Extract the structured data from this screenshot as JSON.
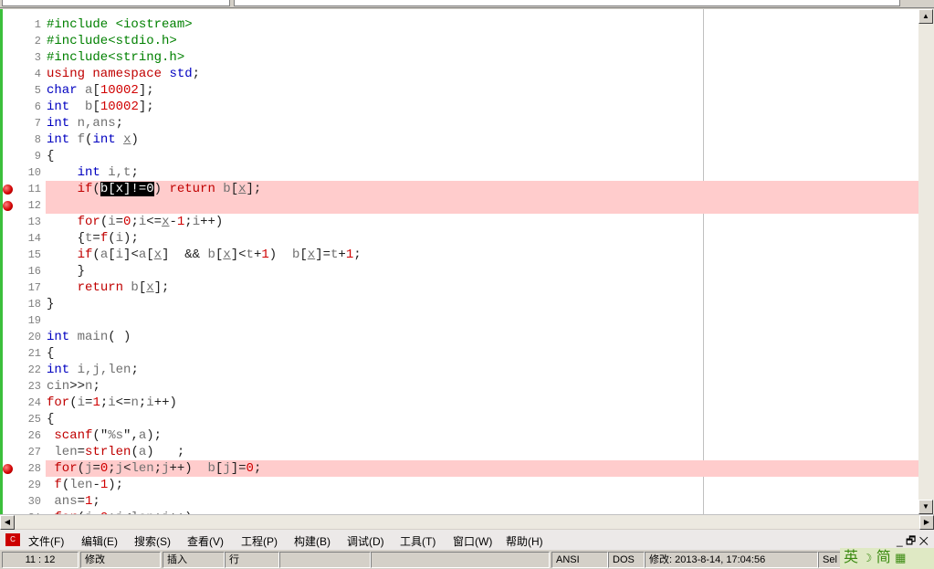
{
  "editor": {
    "breakpoint_color": "#ffcccc",
    "lines": [
      {
        "n": "1",
        "t": [
          [
            "p",
            "#include <iostream>"
          ]
        ]
      },
      {
        "n": "2",
        "t": [
          [
            "p",
            "#include<stdio.h>"
          ]
        ]
      },
      {
        "n": "3",
        "t": [
          [
            "p",
            "#include<string.h>"
          ]
        ]
      },
      {
        "n": "4",
        "t": [
          [
            "r",
            "using namespace"
          ],
          [
            "o",
            " "
          ],
          [
            "k",
            "std"
          ],
          [
            "o",
            ";"
          ]
        ]
      },
      {
        "n": "5",
        "t": [
          [
            "k",
            "char"
          ],
          [
            "i",
            " a"
          ],
          [
            "o",
            "["
          ],
          [
            "n",
            "10002"
          ],
          [
            "o",
            "];"
          ]
        ]
      },
      {
        "n": "6",
        "t": [
          [
            "k",
            "int"
          ],
          [
            "i",
            "  b"
          ],
          [
            "o",
            "["
          ],
          [
            "n",
            "10002"
          ],
          [
            "o",
            "];"
          ]
        ]
      },
      {
        "n": "7",
        "t": [
          [
            "k",
            "int"
          ],
          [
            "i",
            " n,ans"
          ],
          [
            "o",
            ";"
          ]
        ]
      },
      {
        "n": "8",
        "t": [
          [
            "k",
            "int"
          ],
          [
            "i",
            " f"
          ],
          [
            "o",
            "("
          ],
          [
            "k",
            "int"
          ],
          [
            "i",
            " "
          ],
          [
            "u",
            "x"
          ],
          [
            "o",
            ")"
          ]
        ]
      },
      {
        "n": "9",
        "t": [
          [
            "o",
            "{"
          ]
        ]
      },
      {
        "n": "10",
        "t": [
          [
            "i",
            "    "
          ],
          [
            "k",
            "int"
          ],
          [
            "i",
            " i,t"
          ],
          [
            "o",
            ";"
          ]
        ]
      },
      {
        "n": "11",
        "bp": true,
        "t": [
          [
            "i",
            "    "
          ],
          [
            "r",
            "if"
          ],
          [
            "o",
            "("
          ],
          [
            "s",
            "b[x]!=0"
          ],
          [
            "o",
            ")"
          ],
          [
            "i",
            " "
          ],
          [
            "r",
            "return"
          ],
          [
            "i",
            " b"
          ],
          [
            "o",
            "["
          ],
          [
            "u",
            "x"
          ],
          [
            "o",
            "];"
          ]
        ]
      },
      {
        "n": "12",
        "bp": true,
        "t": []
      },
      {
        "n": "13",
        "t": [
          [
            "i",
            "    "
          ],
          [
            "r",
            "for"
          ],
          [
            "o",
            "("
          ],
          [
            "i",
            "i"
          ],
          [
            "o",
            "="
          ],
          [
            "n",
            "0"
          ],
          [
            "o",
            ";"
          ],
          [
            "i",
            "i"
          ],
          [
            "o",
            "<="
          ],
          [
            "u",
            "x"
          ],
          [
            "o",
            "-"
          ],
          [
            "n",
            "1"
          ],
          [
            "o",
            ";"
          ],
          [
            "i",
            "i"
          ],
          [
            "o",
            "++)"
          ]
        ]
      },
      {
        "n": "14",
        "t": [
          [
            "i",
            "    "
          ],
          [
            "o",
            "{"
          ],
          [
            "i",
            "t"
          ],
          [
            "o",
            "="
          ],
          [
            "r",
            "f"
          ],
          [
            "o",
            "("
          ],
          [
            "i",
            "i"
          ],
          [
            "o",
            ");"
          ]
        ]
      },
      {
        "n": "15",
        "t": [
          [
            "i",
            "    "
          ],
          [
            "r",
            "if"
          ],
          [
            "o",
            "("
          ],
          [
            "i",
            "a"
          ],
          [
            "o",
            "["
          ],
          [
            "i",
            "i"
          ],
          [
            "o",
            "]<"
          ],
          [
            "i",
            "a"
          ],
          [
            "o",
            "["
          ],
          [
            "u",
            "x"
          ],
          [
            "o",
            "]  && "
          ],
          [
            "i",
            "b"
          ],
          [
            "o",
            "["
          ],
          [
            "u",
            "x"
          ],
          [
            "o",
            "]<"
          ],
          [
            "i",
            "t"
          ],
          [
            "o",
            "+"
          ],
          [
            "n",
            "1"
          ],
          [
            "o",
            ")  "
          ],
          [
            "i",
            "b"
          ],
          [
            "o",
            "["
          ],
          [
            "u",
            "x"
          ],
          [
            "o",
            "]="
          ],
          [
            "i",
            "t"
          ],
          [
            "o",
            "+"
          ],
          [
            "n",
            "1"
          ],
          [
            "o",
            ";"
          ]
        ]
      },
      {
        "n": "16",
        "t": [
          [
            "i",
            "    "
          ],
          [
            "o",
            "}"
          ]
        ]
      },
      {
        "n": "17",
        "t": [
          [
            "i",
            "    "
          ],
          [
            "r",
            "return"
          ],
          [
            "i",
            " b"
          ],
          [
            "o",
            "["
          ],
          [
            "u",
            "x"
          ],
          [
            "o",
            "];"
          ]
        ]
      },
      {
        "n": "18",
        "t": [
          [
            "o",
            "}"
          ]
        ]
      },
      {
        "n": "19",
        "t": []
      },
      {
        "n": "20",
        "t": [
          [
            "k",
            "int"
          ],
          [
            "i",
            " main"
          ],
          [
            "o",
            "( )"
          ]
        ]
      },
      {
        "n": "21",
        "t": [
          [
            "o",
            "{"
          ]
        ]
      },
      {
        "n": "22",
        "t": [
          [
            "k",
            "int"
          ],
          [
            "i",
            " i,j,len"
          ],
          [
            "o",
            ";"
          ]
        ]
      },
      {
        "n": "23",
        "t": [
          [
            "i",
            "cin"
          ],
          [
            "o",
            ">>"
          ],
          [
            "i",
            "n"
          ],
          [
            "o",
            ";"
          ]
        ]
      },
      {
        "n": "24",
        "t": [
          [
            "r",
            "for"
          ],
          [
            "o",
            "("
          ],
          [
            "i",
            "i"
          ],
          [
            "o",
            "="
          ],
          [
            "n",
            "1"
          ],
          [
            "o",
            ";"
          ],
          [
            "i",
            "i"
          ],
          [
            "o",
            "<="
          ],
          [
            "i",
            "n"
          ],
          [
            "o",
            ";"
          ],
          [
            "i",
            "i"
          ],
          [
            "o",
            "++)"
          ]
        ]
      },
      {
        "n": "25",
        "t": [
          [
            "o",
            "{"
          ]
        ]
      },
      {
        "n": "26",
        "t": [
          [
            "i",
            " "
          ],
          [
            "r",
            "scanf"
          ],
          [
            "o",
            "(\""
          ],
          [
            "i",
            "%s"
          ],
          [
            "o",
            "\","
          ],
          [
            "i",
            "a"
          ],
          [
            "o",
            ");"
          ]
        ]
      },
      {
        "n": "27",
        "t": [
          [
            "i",
            " len"
          ],
          [
            "o",
            "="
          ],
          [
            "r",
            "strlen"
          ],
          [
            "o",
            "("
          ],
          [
            "i",
            "a"
          ],
          [
            "o",
            ")   ;"
          ]
        ]
      },
      {
        "n": "28",
        "bp": true,
        "t": [
          [
            "i",
            " "
          ],
          [
            "r",
            "for"
          ],
          [
            "o",
            "("
          ],
          [
            "i",
            "j"
          ],
          [
            "o",
            "="
          ],
          [
            "n",
            "0"
          ],
          [
            "o",
            ";"
          ],
          [
            "i",
            "j"
          ],
          [
            "o",
            "<"
          ],
          [
            "i",
            "len"
          ],
          [
            "o",
            ";"
          ],
          [
            "i",
            "j"
          ],
          [
            "o",
            "++)  "
          ],
          [
            "i",
            "b"
          ],
          [
            "o",
            "["
          ],
          [
            "i",
            "j"
          ],
          [
            "o",
            "]="
          ],
          [
            "n",
            "0"
          ],
          [
            "o",
            ";"
          ]
        ]
      },
      {
        "n": "29",
        "t": [
          [
            "i",
            " "
          ],
          [
            "r",
            "f"
          ],
          [
            "o",
            "("
          ],
          [
            "i",
            "len"
          ],
          [
            "o",
            "-"
          ],
          [
            "n",
            "1"
          ],
          [
            "o",
            ");"
          ]
        ]
      },
      {
        "n": "30",
        "t": [
          [
            "i",
            " ans"
          ],
          [
            "o",
            "="
          ],
          [
            "n",
            "1"
          ],
          [
            "o",
            ";"
          ]
        ]
      },
      {
        "n": "31",
        "t": [
          [
            "i",
            " "
          ],
          [
            "r",
            "for"
          ],
          [
            "o",
            "("
          ],
          [
            "i",
            "j"
          ],
          [
            "o",
            "="
          ],
          [
            "n",
            "0"
          ],
          [
            "o",
            ";"
          ],
          [
            "i",
            "j"
          ],
          [
            "o",
            "<"
          ],
          [
            "i",
            "len"
          ],
          [
            "o",
            ";"
          ],
          [
            "i",
            "j"
          ],
          [
            "o",
            "++)"
          ]
        ]
      }
    ]
  },
  "menu": {
    "items": [
      "文件(F)",
      "编辑(E)",
      "搜索(S)",
      "查看(V)",
      "工程(P)",
      "构建(B)",
      "调试(D)",
      "工具(T)",
      "窗口(W)",
      "帮助(H)"
    ]
  },
  "status": {
    "position": "11 : 12",
    "modified": "修改",
    "insert": "插入",
    "line": "行",
    "encoding": "ANSI",
    "lineend": "DOS",
    "modtime": "修改: 2013-8-14, 17:04:56",
    "sel": "Sel"
  },
  "ime": {
    "label": "英",
    "mode": "简"
  }
}
